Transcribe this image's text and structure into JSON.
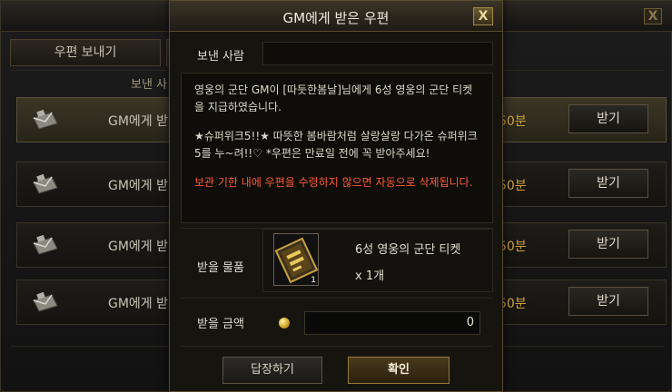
{
  "background": {
    "close_label": "X",
    "tabs": [
      {
        "label": "우편 보내기"
      },
      {
        "label": ""
      }
    ],
    "list_header_sender": "보낸 사",
    "rows": [
      {
        "title": "GM에게 받",
        "time": "50분",
        "button": "받기"
      },
      {
        "title": "GM에게 받",
        "time": "50분",
        "button": "받기"
      },
      {
        "title": "GM에게 받",
        "time": "50분",
        "button": "받기"
      },
      {
        "title": "GM에게 받",
        "time": "50분",
        "button": "받기"
      }
    ]
  },
  "dialog": {
    "title": "GM에게 받은 우편",
    "close_label": "X",
    "sender_label": "보낸 사람",
    "sender_value": "",
    "message": {
      "line1": "영웅의 군단 GM이 [따듯한봄날]님에게 6성 영웅의 군단 티켓을 지급하였습니다.",
      "line2": "★슈퍼위크5!!★ 따뜻한 봄바람처럼 살랑살랑 다가온 슈퍼위크5를 누~려!!♡ *우편은 만료일 전에 꼭 받아주세요!",
      "warning": "보관 기한 내에 우편을 수령하지 않으면 자동으로 삭제됩니다."
    },
    "item_label": "받을 물품",
    "item": {
      "name": "6성 영웅의 군단 티켓",
      "quantity": "x 1개",
      "slot_count": "1",
      "icon": "ticket-icon"
    },
    "money_label": "받을 금액",
    "money_value": "0",
    "reply_button": "답장하기",
    "ok_button": "확인"
  },
  "colors": {
    "accent": "#d0a040",
    "warning": "#ff5a3a",
    "frame": "#5a4c30"
  }
}
